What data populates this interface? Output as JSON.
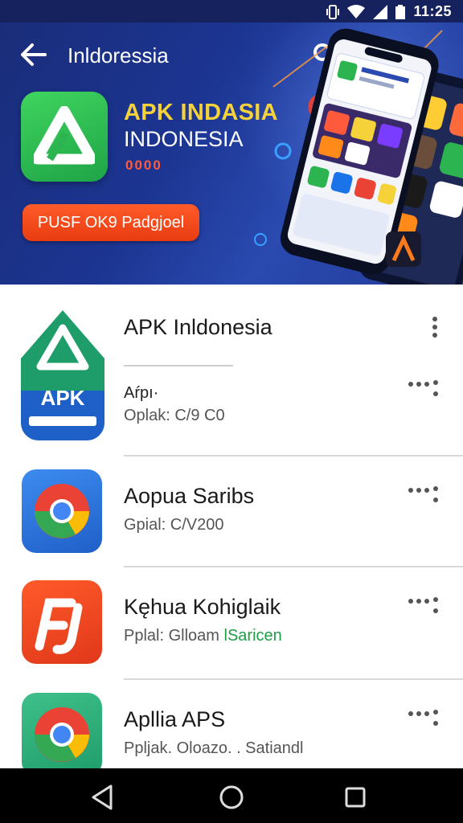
{
  "status_bar": {
    "time": "11:25"
  },
  "header": {
    "title": "Inldoressia",
    "promo_line1": "APK INDASIA",
    "promo_line2": "INDONESIA",
    "promo_dots": "0000",
    "promo_button": "PUSF OK9 Padgjoel"
  },
  "apps": [
    {
      "name": "APK Inldonesia",
      "label": "Aŕpı·",
      "sub": "Oplak: C/9 C0",
      "icon_text": "APK",
      "icon": "apk-indonesia-icon"
    },
    {
      "name": "Aopua Saribs",
      "sub": "Gpial: C/V200",
      "icon": "chrome-style-icon"
    },
    {
      "name": "Kęhua Kohiglaik",
      "sub": "Pplal: Glloam",
      "sub_green": "lSaricen",
      "icon": "fj-icon"
    },
    {
      "name": "Apllia APS",
      "sub": "Ppljak. Oloazo. . Satiandl",
      "icon": "chrome-style-icon"
    }
  ],
  "colors": {
    "header_bg": "#1c3592",
    "accent_green": "#1e9d46",
    "promo_orange": "#f04a1a",
    "promo_yellow": "#f6d23a"
  }
}
